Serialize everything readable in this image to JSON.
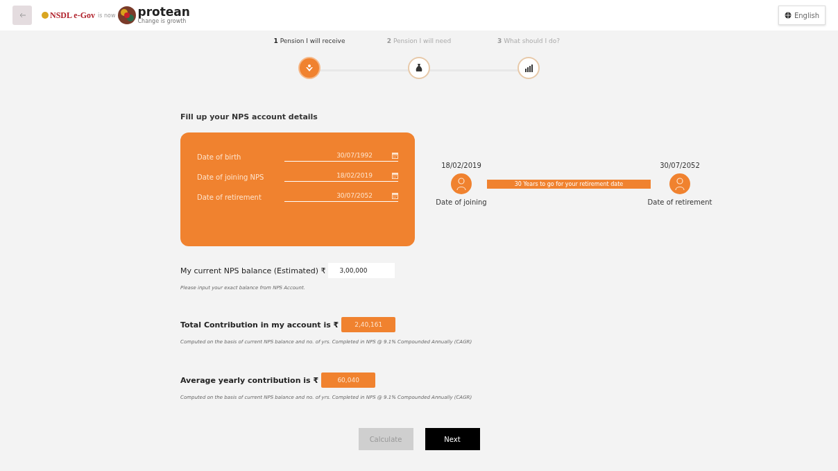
{
  "header": {
    "brand": "NSDL e-Gov",
    "brand_note": "is now",
    "logo_name": "protean",
    "logo_tagline": "Change is growth",
    "language": "English"
  },
  "steps": [
    {
      "number": "1",
      "label": "Pension I will receive",
      "selected": true,
      "kind": "pension"
    },
    {
      "number": "2",
      "label": "Pension I will need",
      "selected": false,
      "kind": "money"
    },
    {
      "number": "3",
      "label": "What should I do?",
      "selected": false,
      "kind": "chart"
    }
  ],
  "section_title": "Fill up your NPS account details",
  "dates": [
    {
      "label": "Date of birth",
      "value": "30/07/1992"
    },
    {
      "label": "Date of joining NPS",
      "value": "18/02/2019"
    },
    {
      "label": "Date of retirement",
      "value": "30/07/2052"
    }
  ],
  "timeline": {
    "start_date": "18/02/2019",
    "start_label": "Date of joining",
    "end_date": "30/07/2052",
    "end_label": "Date of retirement",
    "bar_text": "30 Years to go for your retirement date"
  },
  "balance": {
    "label": "My current NPS balance (Estimated) ₹",
    "value": "3,00,000",
    "hint": "Please input your exact balance from NPS Account."
  },
  "results": [
    {
      "label": "Total Contribution in my account is ₹",
      "value": "2,40,161",
      "note": "Computed on the basis of current NPS balance and no. of yrs. Completed in NPS @ 9.1% Compounded Annually (CAGR)"
    },
    {
      "label": "Average yearly contribution is ₹",
      "value": "60,040",
      "note": "Computed on the basis of current NPS balance and no. of yrs. Completed in NPS @ 9.1% Compounded Annually (CAGR)"
    }
  ],
  "buttons": [
    {
      "label": "Calculate",
      "disabled": true
    },
    {
      "label": "Next",
      "disabled": false
    }
  ]
}
